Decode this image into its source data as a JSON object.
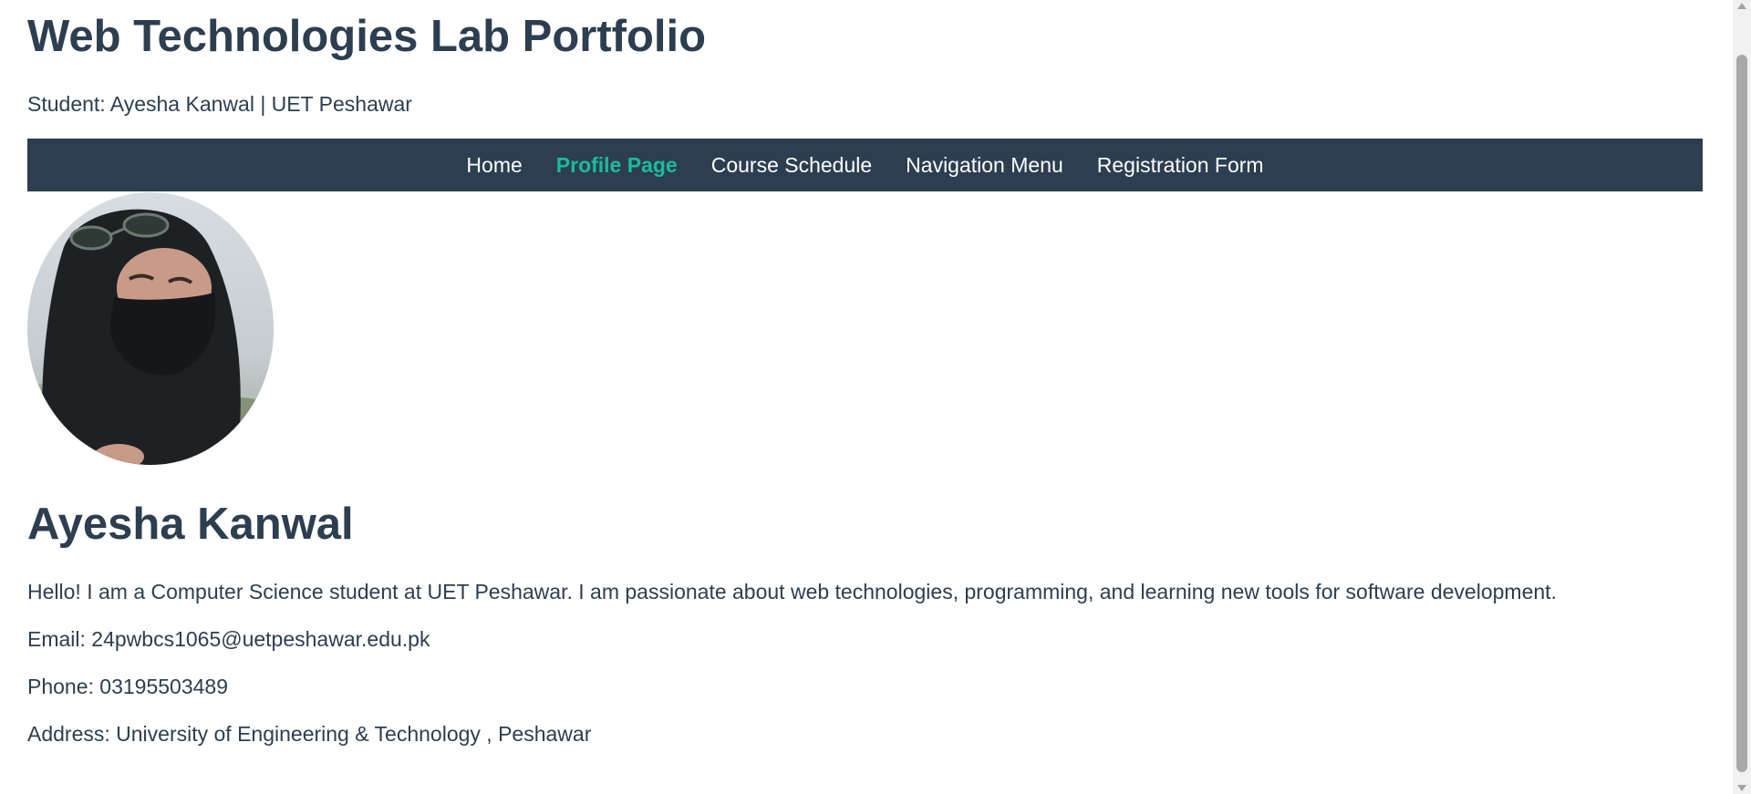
{
  "header": {
    "title": "Web Technologies Lab Portfolio",
    "subtitle": "Student: Ayesha Kanwal | UET Peshawar"
  },
  "nav": {
    "items": [
      {
        "label": "Home"
      },
      {
        "label": "Profile Page",
        "active": true
      },
      {
        "label": "Course Schedule"
      },
      {
        "label": "Navigation Menu"
      },
      {
        "label": "Registration Form"
      }
    ]
  },
  "profile": {
    "name": "Ayesha Kanwal",
    "bio": "Hello! I am a Computer Science student at UET Peshawar. I am passionate about web technologies, programming, and learning new tools for software development.",
    "email": "Email: 24pwbcs1065@uetpeshawar.edu.pk",
    "phone": "Phone: 03195503489",
    "address": "Address: University of Engineering & Technology , Peshawar"
  },
  "colors": {
    "primary": "#2c3e50",
    "accent": "#1abc9c",
    "nav_text": "#ffffff"
  },
  "icons": {
    "scroll_up": "scroll-up-arrow-icon",
    "scroll_down": "scroll-down-arrow-icon"
  }
}
